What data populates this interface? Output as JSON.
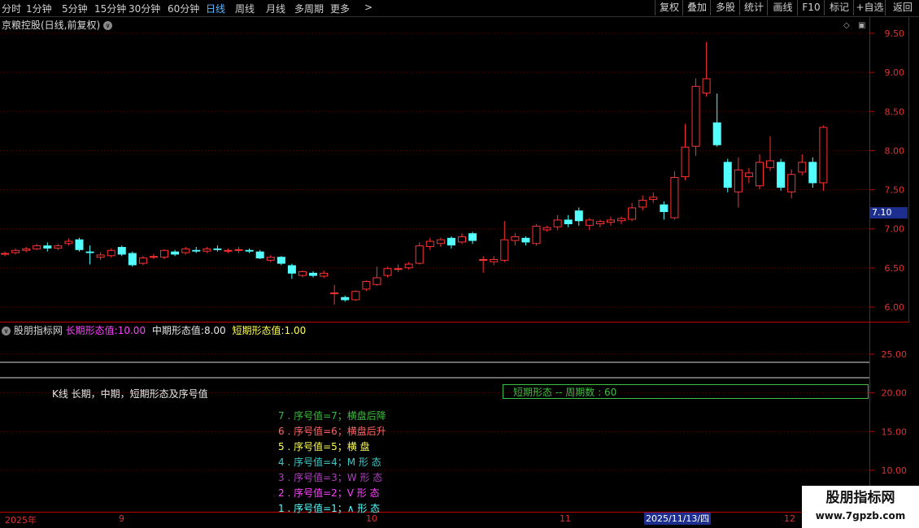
{
  "toolbar": {
    "left_items": [
      "分时",
      "1分钟",
      "5分钟",
      "15分钟",
      "30分钟",
      "60分钟",
      "日线",
      "周线",
      "月线",
      "多周期",
      "更多"
    ],
    "active_item": "日线",
    "more_arrow": ">",
    "right_items": [
      "复权",
      "叠加",
      "多股",
      "统计",
      "画线",
      "F10",
      "标记",
      "+自选",
      "返回"
    ]
  },
  "stock": {
    "title": "京粮控股(日线,前复权)",
    "dropdown_glyph": "∨"
  },
  "price_axis": {
    "ticks": [
      "9.50",
      "9.00",
      "8.50",
      "8.00",
      "7.50",
      "7.00",
      "6.50",
      "6.00"
    ],
    "current_price": "7.10"
  },
  "indicator": {
    "name": "股朋指标网",
    "long_label": "长期形态值:",
    "long_value": "10.00",
    "mid_label": "中期形态值:",
    "mid_value": "8.00",
    "short_label": "短期形态值:",
    "short_value": "1.00",
    "note": "K线 长期，中期，短期形态及序号值",
    "short_box": "短期形态 -- 周期数 : 60",
    "axis_ticks": [
      "25.00",
      "20.00",
      "15.00",
      "10.00"
    ],
    "legend": [
      {
        "text": "7 . 序号值=7；横盘后降",
        "color": "#3dbb3d"
      },
      {
        "text": "6 . 序号值=6；横盘后升",
        "color": "#ff6666"
      },
      {
        "text": "5 . 序号值=5；横 盘",
        "color": "#ffff55"
      },
      {
        "text": "4 . 序号值=4；M 形 态",
        "color": "#3fc7c7"
      },
      {
        "text": "3 . 序号值=3；W 形 态",
        "color": "#b040c0"
      },
      {
        "text": "2 . 序号值=2；V 形 态",
        "color": "#ff44ff"
      },
      {
        "text": "1 . 序号值=1；∧ 形 态",
        "color": "#55ffff"
      }
    ]
  },
  "date_axis": {
    "labels": [
      "2025年",
      "9",
      "10",
      "11",
      "12"
    ],
    "cursor": "2025/11/13/四"
  },
  "watermark": {
    "line1": "股朋指标网",
    "line2": "www.7gpzb.com"
  },
  "colors": {
    "up": "#ff3232",
    "down": "#54ffff",
    "axis": "#c00000"
  },
  "chart_data": {
    "type": "candlestick",
    "ylim": [
      5.85,
      9.7
    ],
    "candles": [
      [
        6.68,
        6.7,
        6.72,
        6.66
      ],
      [
        6.7,
        6.74,
        6.76,
        6.68
      ],
      [
        6.73,
        6.76,
        6.78,
        6.71
      ],
      [
        6.75,
        6.8,
        6.82,
        6.74
      ],
      [
        6.8,
        6.76,
        6.84,
        6.72
      ],
      [
        6.76,
        6.8,
        6.82,
        6.74
      ],
      [
        6.82,
        6.86,
        6.89,
        6.8
      ],
      [
        6.88,
        6.74,
        6.9,
        6.72
      ],
      [
        6.72,
        6.7,
        6.8,
        6.55
      ],
      [
        6.64,
        6.68,
        6.71,
        6.61
      ],
      [
        6.66,
        6.74,
        6.76,
        6.64
      ],
      [
        6.78,
        6.68,
        6.8,
        6.66
      ],
      [
        6.7,
        6.54,
        6.72,
        6.52
      ],
      [
        6.56,
        6.64,
        6.66,
        6.54
      ],
      [
        6.64,
        6.66,
        6.69,
        6.62
      ],
      [
        6.64,
        6.74,
        6.75,
        6.62
      ],
      [
        6.72,
        6.68,
        6.74,
        6.66
      ],
      [
        6.7,
        6.76,
        6.78,
        6.68
      ],
      [
        6.74,
        6.72,
        6.78,
        6.7
      ],
      [
        6.72,
        6.76,
        6.78,
        6.7
      ],
      [
        6.76,
        6.74,
        6.8,
        6.72
      ],
      [
        6.72,
        6.74,
        6.76,
        6.7
      ],
      [
        6.75,
        6.75,
        6.78,
        6.7
      ],
      [
        6.74,
        6.72,
        6.76,
        6.7
      ],
      [
        6.72,
        6.63,
        6.74,
        6.62
      ],
      [
        6.6,
        6.65,
        6.67,
        6.58
      ],
      [
        6.65,
        6.56,
        6.66,
        6.54
      ],
      [
        6.54,
        6.43,
        6.56,
        6.36
      ],
      [
        6.4,
        6.46,
        6.47,
        6.38
      ],
      [
        6.44,
        6.4,
        6.46,
        6.38
      ],
      [
        6.39,
        6.44,
        6.47,
        6.37
      ],
      [
        6.18,
        6.18,
        6.28,
        6.02
      ],
      [
        6.12,
        6.08,
        6.14,
        6.06
      ],
      [
        6.08,
        6.2,
        6.21,
        6.07
      ],
      [
        6.22,
        6.33,
        6.34,
        6.2
      ],
      [
        6.28,
        6.38,
        6.52,
        6.27
      ],
      [
        6.4,
        6.5,
        6.52,
        6.38
      ],
      [
        6.5,
        6.5,
        6.55,
        6.45
      ],
      [
        6.5,
        6.56,
        6.58,
        6.48
      ],
      [
        6.56,
        6.8,
        6.84,
        6.55
      ],
      [
        6.78,
        6.86,
        6.9,
        6.74
      ],
      [
        6.82,
        6.88,
        6.9,
        6.78
      ],
      [
        6.9,
        6.8,
        6.92,
        6.76
      ],
      [
        6.84,
        6.92,
        6.96,
        6.82
      ],
      [
        6.96,
        6.86,
        6.98,
        6.82
      ],
      [
        6.6,
        6.62,
        6.66,
        6.44
      ],
      [
        6.58,
        6.62,
        6.66,
        6.54
      ],
      [
        6.6,
        6.88,
        7.12,
        6.58
      ],
      [
        6.86,
        6.92,
        6.96,
        6.8
      ],
      [
        6.9,
        6.84,
        6.92,
        6.8
      ],
      [
        6.82,
        7.06,
        7.08,
        6.8
      ],
      [
        7.0,
        7.04,
        7.06,
        6.98
      ],
      [
        7.04,
        7.14,
        7.2,
        7.0
      ],
      [
        7.14,
        7.08,
        7.2,
        7.04
      ],
      [
        7.26,
        7.12,
        7.3,
        7.06
      ],
      [
        7.06,
        7.14,
        7.16,
        7.0
      ],
      [
        7.08,
        7.12,
        7.14,
        7.04
      ],
      [
        7.1,
        7.14,
        7.18,
        7.06
      ],
      [
        7.12,
        7.16,
        7.18,
        7.08
      ],
      [
        7.14,
        7.3,
        7.36,
        7.12
      ],
      [
        7.3,
        7.4,
        7.46,
        7.26
      ],
      [
        7.4,
        7.44,
        7.5,
        7.36
      ],
      [
        7.34,
        7.24,
        7.38,
        7.14
      ],
      [
        7.16,
        7.7,
        7.78,
        7.14
      ],
      [
        7.7,
        8.1,
        8.4,
        7.66
      ],
      [
        8.1,
        8.9,
        9.0,
        7.98
      ],
      [
        8.8,
        9.0,
        9.48,
        8.76
      ],
      [
        8.42,
        8.12,
        8.8,
        8.1
      ],
      [
        7.9,
        7.56,
        7.94,
        7.5
      ],
      [
        7.5,
        7.8,
        7.96,
        7.3
      ],
      [
        7.7,
        7.76,
        7.82,
        7.62
      ],
      [
        7.58,
        7.9,
        8.0,
        7.54
      ],
      [
        7.82,
        7.92,
        8.24,
        7.78
      ],
      [
        7.9,
        7.56,
        7.94,
        7.52
      ],
      [
        7.5,
        7.74,
        7.8,
        7.42
      ],
      [
        7.76,
        7.9,
        8.0,
        7.72
      ],
      [
        7.9,
        7.62,
        7.96,
        7.56
      ],
      [
        7.62,
        8.36,
        8.38,
        7.52
      ]
    ]
  }
}
